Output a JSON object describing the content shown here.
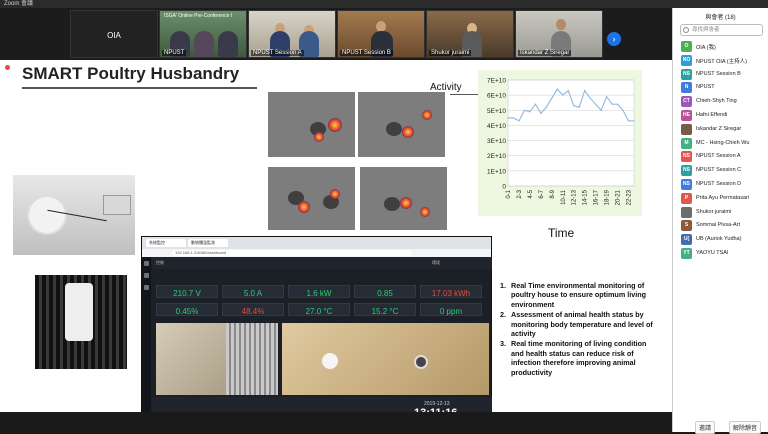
{
  "window": {
    "title": "Zoom 會議"
  },
  "video_strip": {
    "tiles": [
      {
        "label": "OIA"
      },
      {
        "label": "NPUST"
      },
      {
        "label": "NPUST Session A"
      },
      {
        "label": "NPUST Session B"
      },
      {
        "label": "Shukor juraimi"
      },
      {
        "label": "Iskandar Z Siregar"
      }
    ],
    "banner_text": "ISGA' Online Pre-Conference I"
  },
  "slide": {
    "title": "SMART Poultry Husbandry",
    "bullets": [
      {
        "num": "1.",
        "text": "Real Time environmental monitoring  of poultry house to ensure optimum living environment"
      },
      {
        "num": "2.",
        "text": "Assessment of animal health status by monitoring body temperature and level of activity"
      },
      {
        "num": "3.",
        "text": "Real time monitoring of living condition and health status can reduce risk of infection therefore improving animal productivity"
      }
    ]
  },
  "chart_data": {
    "type": "line",
    "title": "Activity",
    "xlabel": "Time",
    "ylabel": "",
    "categories": [
      "0-1",
      "2-3",
      "4-5",
      "6-7",
      "8-9",
      "10-11",
      "12-13",
      "14-15",
      "16-17",
      "18-19",
      "20-21",
      "22-23"
    ],
    "ytick_labels": [
      "0",
      "1E+10",
      "2E+10",
      "3E+10",
      "4E+10",
      "5E+10",
      "6E+10",
      "7E+10"
    ],
    "ylim": [
      0,
      70000000000
    ],
    "x_points": 24,
    "values": [
      45000000000.0,
      45000000000.0,
      43000000000.0,
      50000000000.0,
      49000000000.0,
      54000000000.0,
      48000000000.0,
      52000000000.0,
      58000000000.0,
      64000000000.0,
      60000000000.0,
      63000000000.0,
      53000000000.0,
      52000000000.0,
      63000000000.0,
      58000000000.0,
      54000000000.0,
      50000000000.0,
      59000000000.0,
      54000000000.0,
      54000000000.0,
      50000000000.0,
      43000000000.0,
      43000000000.0
    ],
    "line_color": "#8fb8e0",
    "grid": true,
    "legend": "none"
  },
  "dashboard": {
    "tabs": [
      "系統監控",
      "動物體溫監測",
      "控制",
      "環境"
    ],
    "url": "192.168.1.3:8080/dashboard",
    "metrics_row1": [
      "210.7 V",
      "5.0 A",
      "1.6 kW",
      "0.85",
      "17.03 kWh"
    ],
    "metrics_row2": [
      "0.45%",
      "48.4%",
      "27.0 °C",
      "15.2 °C",
      "0 ppm"
    ],
    "metric_colors_row1": [
      "#2ecc71",
      "#2ecc71",
      "#2ecc71",
      "#2ecc71",
      "#e74c3c"
    ],
    "metric_colors_row2": [
      "#2ecc71",
      "#e74c3c",
      "#2ecc71",
      "#2ecc71",
      "#2ecc71"
    ],
    "clock_date": "2019-12-13",
    "clock_time": "13:11:16"
  },
  "participants_panel": {
    "title": "與會者 (18)",
    "search_placeholder": "尋找與會者",
    "participants": [
      {
        "initials": "O",
        "name": "OIA (我)",
        "color": "#4caf50"
      },
      {
        "initials": "NO",
        "name": "NPUST OIA (主持人)",
        "color": "#2e9dd8"
      },
      {
        "initials": "NS",
        "name": "NPUST Session B",
        "color": "#2ea0a0"
      },
      {
        "initials": "N",
        "name": "NPUST",
        "color": "#3f7be0"
      },
      {
        "initials": "CT",
        "name": "Chieh-Shyh Ting",
        "color": "#9b59b6"
      },
      {
        "initials": "HE",
        "name": "Hafni Effendi",
        "color": "#c0509a"
      },
      {
        "initials": "",
        "name": "Iskandar Z Siregar",
        "color": "#7a5a46"
      },
      {
        "initials": "M",
        "name": "MC - Hsing-Chieh Wu",
        "color": "#43b081"
      },
      {
        "initials": "NS",
        "name": "NPUST Session A",
        "color": "#e2574c"
      },
      {
        "initials": "NS",
        "name": "NPUST Session C",
        "color": "#2ea0a0"
      },
      {
        "initials": "NS",
        "name": "NPUST Session D",
        "color": "#3f7be0"
      },
      {
        "initials": "P",
        "name": "Prita Ayu Permatasari",
        "color": "#e2574c"
      },
      {
        "initials": "",
        "name": "Shukor juraimi",
        "color": "#6d6d6d"
      },
      {
        "initials": "S",
        "name": "Sommai Pivsa-Art",
        "color": "#8e5a3c"
      },
      {
        "initials": "U(",
        "name": "UB (Auriok Yudha)",
        "color": "#3f6fb0"
      },
      {
        "initials": "YT",
        "name": "YAOYU TSAI",
        "color": "#43b081"
      }
    ],
    "invite_label": "邀請",
    "unmute_label": "解除靜音"
  }
}
